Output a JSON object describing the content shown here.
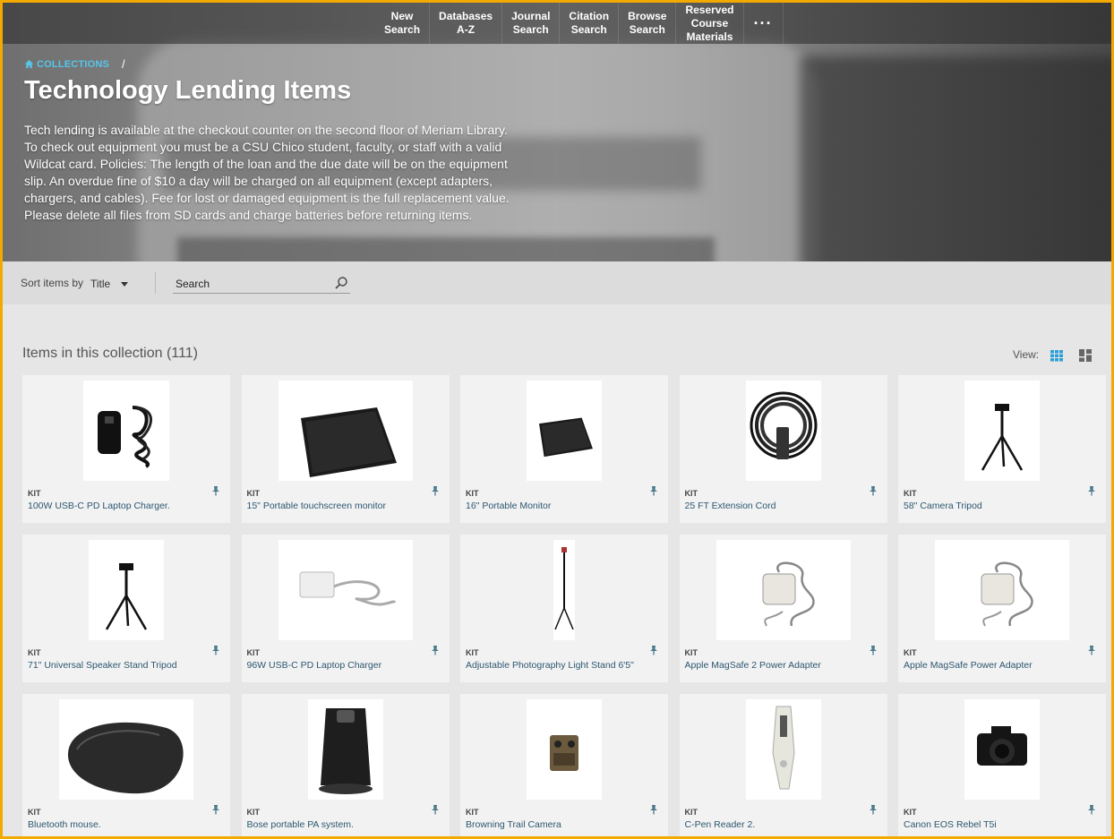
{
  "nav": {
    "items": [
      "New\nSearch",
      "Databases\nA-Z",
      "Journal\nSearch",
      "Citation\nSearch",
      "Browse\nSearch",
      "Reserved\nCourse\nMaterials"
    ],
    "more": "···"
  },
  "breadcrumb": {
    "home": "COLLECTIONS",
    "separator": "/"
  },
  "page": {
    "title": "Technology Lending Items",
    "description": "Tech lending is available at the checkout counter on the second floor of Meriam Library. To check out equipment you must be a CSU Chico student, faculty, or staff with a valid Wildcat card. Policies: The length of the loan and the due date will be on the equipment slip. An overdue fine of $10 a day will be charged on all equipment (except adapters, chargers, and cables). Fee for lost or damaged equipment is the full replacement value. Please delete all files from SD cards and charge batteries before returning items."
  },
  "toolbar": {
    "sort_label": "Sort items by",
    "sort_value": "Title",
    "search_placeholder": "Search"
  },
  "collection": {
    "heading": "Items in this collection (111)",
    "view_label": "View:"
  },
  "colors": {
    "accent": "#f2a900",
    "link": "#2c5770",
    "breadcrumb": "#55c6ea",
    "view_active": "#2a9fd6"
  },
  "items": [
    {
      "type": "KIT",
      "title": "100W USB-C PD Laptop Charger.",
      "icon": "charger-cable-image"
    },
    {
      "type": "KIT",
      "title": "15\" Portable touchscreen monitor",
      "icon": "monitor-image"
    },
    {
      "type": "KIT",
      "title": "16\" Portable Monitor",
      "icon": "monitor-image"
    },
    {
      "type": "KIT",
      "title": "25 FT Extension Cord",
      "icon": "extension-cord-image"
    },
    {
      "type": "KIT",
      "title": "58\" Camera Tripod",
      "icon": "tripod-image"
    },
    {
      "type": "KIT",
      "title": "71\" Universal Speaker Stand Tripod",
      "icon": "tripod-image"
    },
    {
      "type": "KIT",
      "title": "96W USB-C PD Laptop Charger",
      "icon": "adapter-image"
    },
    {
      "type": "KIT",
      "title": "Adjustable Photography Light Stand 6'5\"",
      "icon": "light-stand-image"
    },
    {
      "type": "KIT",
      "title": "Apple MagSafe 2 Power Adapter",
      "icon": "magsafe-image"
    },
    {
      "type": "KIT",
      "title": "Apple MagSafe Power Adapter",
      "icon": "magsafe-image"
    },
    {
      "type": "KIT",
      "title": "Bluetooth mouse.",
      "icon": "mouse-image"
    },
    {
      "type": "KIT",
      "title": "Bose portable PA system.",
      "icon": "pa-system-image"
    },
    {
      "type": "KIT",
      "title": "Browning Trail Camera",
      "icon": "trail-camera-image"
    },
    {
      "type": "KIT",
      "title": "C-Pen Reader 2.",
      "icon": "pen-reader-image"
    },
    {
      "type": "KIT",
      "title": "Canon EOS Rebel T5i",
      "icon": "dslr-camera-image"
    }
  ]
}
